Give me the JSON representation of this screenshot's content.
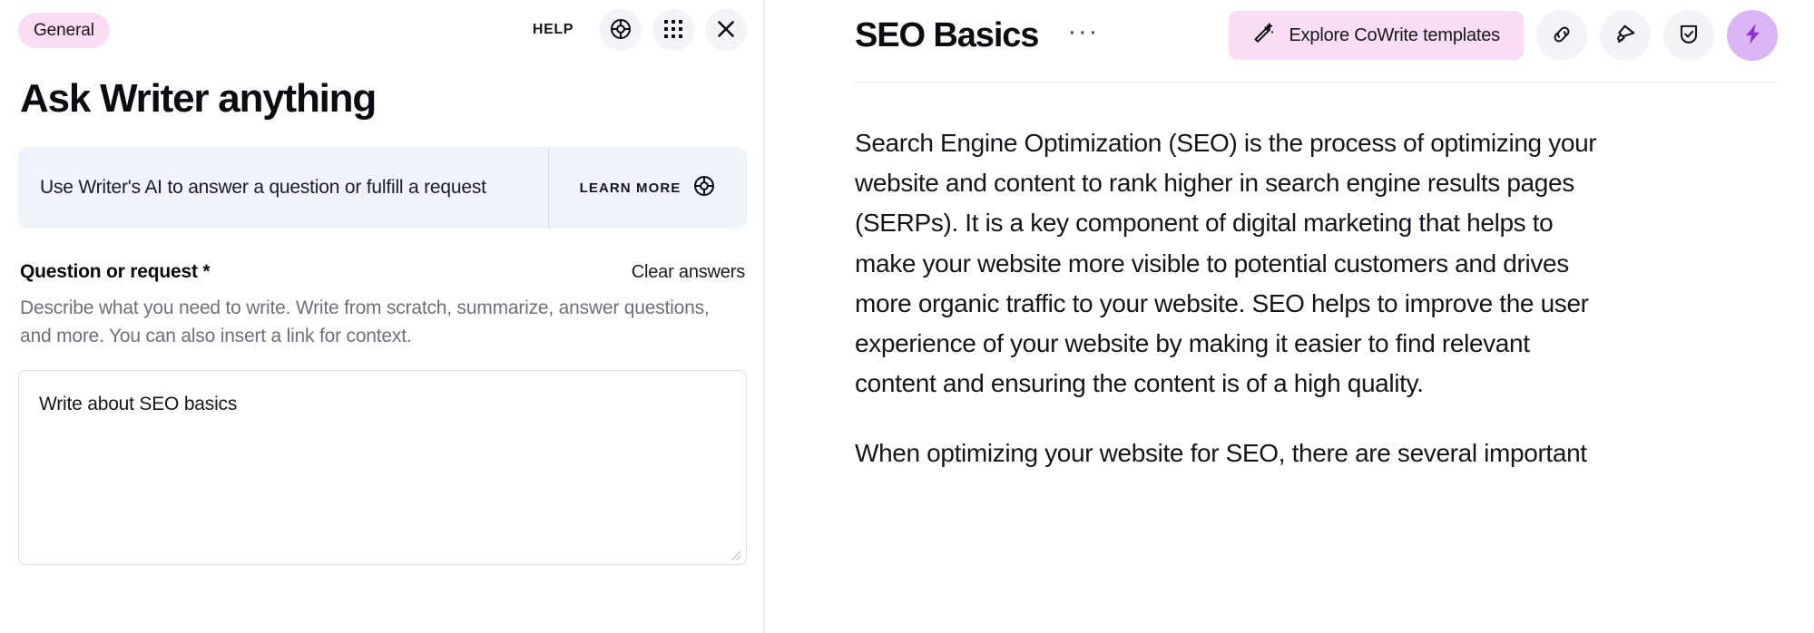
{
  "left_panel": {
    "badge": "General",
    "help_label": "HELP",
    "icons": {
      "lifebuoy": "lifebuoy-icon",
      "apps_grid": "apps-grid-icon",
      "close": "close-icon"
    },
    "title": "Ask Writer anything",
    "info_box": {
      "text": "Use Writer's AI to answer a question or fulfill a request",
      "learn_more_label": "LEARN MORE",
      "learn_more_icon": "lifebuoy-icon"
    },
    "form": {
      "field_label": "Question or request *",
      "clear_answers_label": "Clear answers",
      "field_help": "Describe what you need to write. Write from scratch, summarize, answer questions, and more. You can also insert a link for context.",
      "textarea_value": "Write about SEO basics",
      "textarea_placeholder": ""
    }
  },
  "right_panel": {
    "doc_title": "SEO Basics",
    "more_label": "···",
    "cowrite_button_label": "Explore CoWrite templates",
    "cowrite_button_icon": "magic-wand-icon",
    "toolbar_icons": [
      {
        "name": "link-icon",
        "active": false
      },
      {
        "name": "megaphone-icon",
        "active": false
      },
      {
        "name": "shield-check-icon",
        "active": false
      },
      {
        "name": "lightning-bolt-icon",
        "active": true
      }
    ],
    "paragraphs": [
      "Search Engine Optimization (SEO) is the process of optimizing your website and content to rank higher in search engine results pages (SERPs). It is a key component of digital marketing that helps to make your website more visible to potential customers and drives more organic traffic to your website. SEO helps to improve the user experience of your website by making it easier to find relevant content and ensuring the content is of a high quality.",
      "When optimizing your website for SEO, there are several important"
    ]
  },
  "colors": {
    "badge_pink": "#fadcf5",
    "info_box_bg": "#f2f2fb",
    "icon_btn_bg": "#f4f3f8",
    "accent_purple_bg": "#dab4f5",
    "accent_purple_fg": "#8b2fd6",
    "divider": "#eceaf3",
    "text_primary": "#16161a",
    "text_muted": "#6f6f78"
  }
}
